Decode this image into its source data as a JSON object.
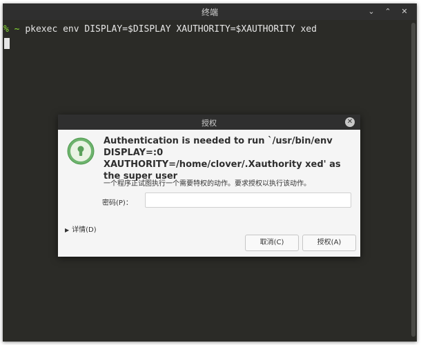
{
  "terminal": {
    "title": "终端",
    "prompt_symbol": "%",
    "prompt_path": "~",
    "command": "pkexec env DISPLAY=$DISPLAY XAUTHORITY=$XAUTHORITY xed",
    "buttons": {
      "minimize": "⌄",
      "maximize": "⌃",
      "close": "✕"
    }
  },
  "dialog": {
    "title": "授权",
    "close_label": "✕",
    "heading": "Authentication is needed to run `/usr/bin/env DISPLAY=:0 XAUTHORITY=/home/clover/.Xauthority xed' as the super user",
    "description": "一个程序正试图执行一个需要特权的动作。要求授权以执行该动作。",
    "password_label": "密码(P)：",
    "password_value": "",
    "details_label": "详情(D)",
    "cancel_label": "取消(C)",
    "authorize_label": "授权(A)"
  },
  "colors": {
    "terminal_bg": "#2b2b27",
    "titlebar_bg": "#2f2f2f",
    "prompt_green": "#8ae234",
    "lock_icon_green": "#6db36d"
  }
}
